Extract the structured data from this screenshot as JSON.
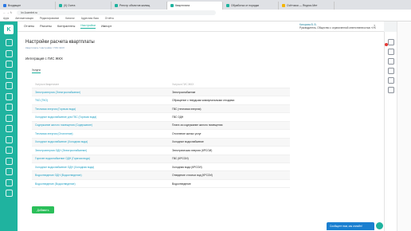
{
  "browser": {
    "tabs": [
      {
        "label": "Входящие",
        "color": "#2b78e4"
      },
      {
        "label": "(0) Счета",
        "color": "#1fb39f"
      },
      {
        "label": "Реестр объектов жилищ",
        "color": "#1fb39f"
      },
      {
        "label": "Квартплата",
        "color": "#1fb39f",
        "active": true
      },
      {
        "label": "Обработка от порядки",
        "color": "#1fb39f"
      },
      {
        "label": "Счётчики — Яндекс.Мет",
        "color": "#f4b400"
      }
    ],
    "address": "kv.1cambrt.ru",
    "bookmarks": [
      "Apps",
      "Автоматизация",
      "Редактирование",
      "Каталог",
      "Адресная база",
      "Отчёты"
    ]
  },
  "topnav": {
    "items": [
      "Отчеты",
      "Расчеты",
      "Контрагенты",
      "Настройки",
      "Импорт"
    ],
    "active_index": 3
  },
  "user": {
    "name": "Каторова В. В.",
    "org": "Руководитель, Общество с ограниченной ответственностью «УК"
  },
  "page": {
    "title": "Настройки расчета квартплаты",
    "breadcrumb": "Квартплата / Настройки / ГИС ЖКХ",
    "subtitle": "Интеграция с ГИС ЖКХ",
    "tab": "Услуги"
  },
  "table": {
    "headers": [
      "Услуга в Квартплате",
      "Услуга в ГИС ЖКХ"
    ],
    "rows": [
      [
        "Электроэнергия (Электроснабжение)",
        "Электроснабжение"
      ],
      [
        "ТКО (ТКО)",
        "Обращение с твердыми коммунальными отходами"
      ],
      [
        "Тепловая энергия (Горячая вода)",
        "ГВС (тепловая энергия)"
      ],
      [
        "Холодное водоснабжение для ГВС (Горячая вода)",
        "ГВС ОДН"
      ],
      [
        "Содержание жилого помещения (Содержание)",
        "Плата за содержание жилого помещения"
      ],
      [
        "Тепловая энергия (Отопление)",
        "Отопление жилых услуг"
      ],
      [
        "Холодное водоснабжение (Холодная вода)",
        "Холодное водоснабжение"
      ],
      [
        "Электроэнергия ОДН (Электроснабжение)",
        "Электрическая энергия (КРСОИ)"
      ],
      [
        "Горячее водоснабжение ОДН (Горячая вода)",
        "ГВС (КРСОИ)"
      ],
      [
        "Холодное водоснабжение ОДН (Холодная вода)",
        "Холодная вода (КРСОИ)"
      ],
      [
        "Водоотведение ОДН (Водоотведение)",
        "Отведение сточных вод (КРСОИ)"
      ],
      [
        "Водоотведение (Водоотведение)",
        "Водоотведение"
      ]
    ],
    "add_label": "Добавить"
  },
  "chat": {
    "label": "Сообщите нам, мы онлайн!"
  }
}
